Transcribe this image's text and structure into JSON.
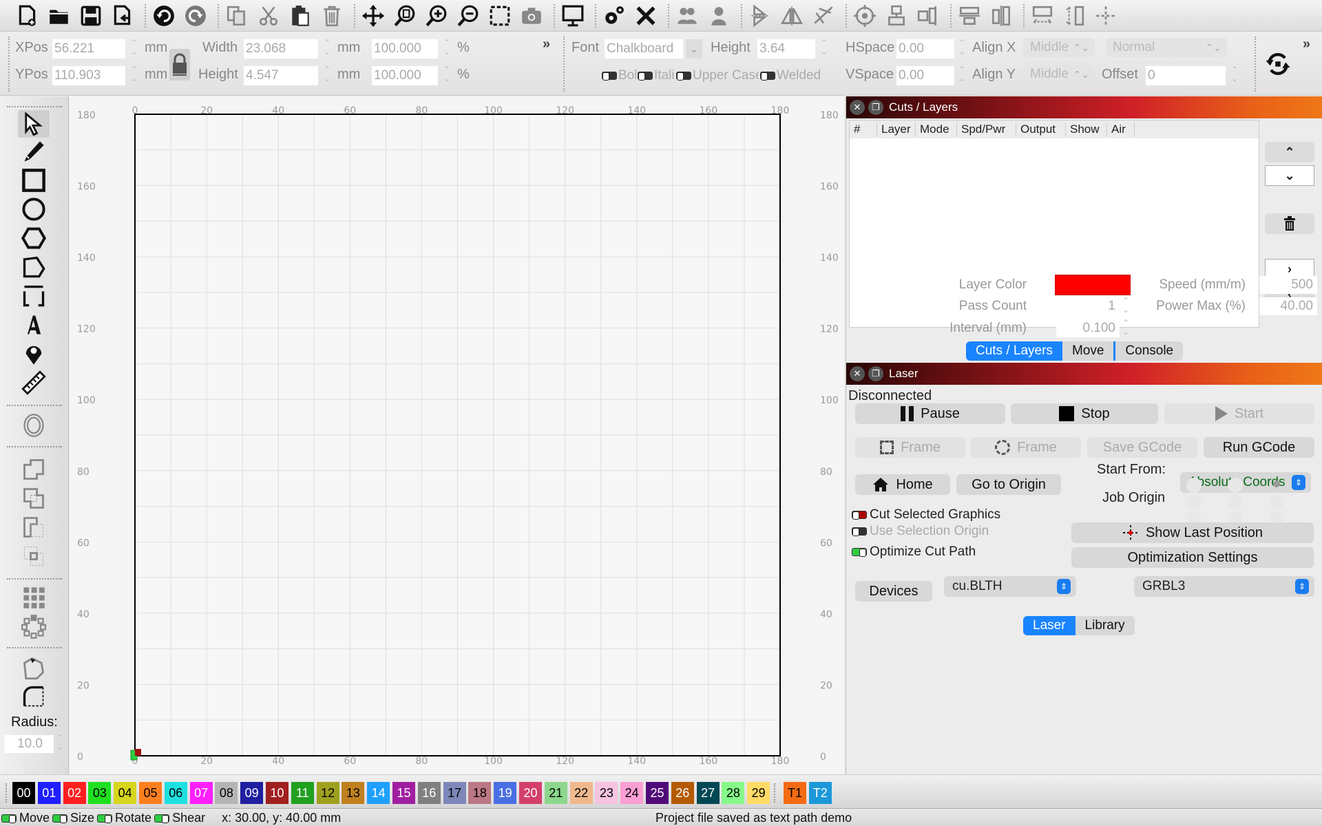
{
  "toolbar": {
    "icons": [
      "new-file-icon",
      "open-folder-icon",
      "save-icon",
      "import-icon",
      "undo-icon",
      "redo-icon",
      "copy-icon",
      "cut-icon",
      "paste-icon",
      "delete-icon",
      "move-icon",
      "zoom-to-page-icon",
      "zoom-in-icon",
      "zoom-out-icon",
      "frame-selection-icon",
      "camera-icon",
      "monitor-icon",
      "settings-icon",
      "tools-icon",
      "group-icon",
      "ungroup-icon",
      "flip-vertical-icon",
      "flip-horizontal-icon",
      "mirror-icon",
      "target-icon",
      "align-center-icon",
      "align-right-icon",
      "distribute-horizontal-icon",
      "distribute-vertical-icon",
      "resize-width-icon",
      "resize-height-icon",
      "dock-icon"
    ]
  },
  "properties": {
    "xpos_label": "XPos",
    "xpos_value": "56.221",
    "ypos_label": "YPos",
    "ypos_value": "110.903",
    "unit": "mm",
    "width_label": "Width",
    "width_value": "23.068",
    "height_label": "Height",
    "height_value": "4.547",
    "scale_w": "100.000",
    "scale_h": "100.000",
    "percent": "%",
    "more": "»"
  },
  "text_props": {
    "font_label": "Font",
    "font_value": "Chalkboard",
    "height_label": "Height",
    "height_value": "3.64",
    "hspace_label": "HSpace",
    "hspace_value": "0.00",
    "vspace_label": "VSpace",
    "vspace_value": "0.00",
    "alignx_label": "Align X",
    "alignx_value": "Middle",
    "aligny_label": "Align Y",
    "aligny_value": "Middle",
    "style_value": "Normal",
    "offset_label": "Offset",
    "offset_value": "0",
    "bold": "Bold",
    "italic": "Italic",
    "upper": "Upper Case",
    "welded": "Welded"
  },
  "left_tools": {
    "radius_label": "Radius:",
    "radius_value": "10.0"
  },
  "canvas": {
    "x_ticks": [
      "0",
      "20",
      "40",
      "60",
      "80",
      "100",
      "120",
      "140",
      "160",
      "180"
    ],
    "y_ticks": [
      "180",
      "160",
      "140",
      "120",
      "100",
      "80",
      "60",
      "40",
      "20",
      "0"
    ]
  },
  "cuts_panel": {
    "title": "Cuts / Layers",
    "columns": [
      "#",
      "Layer",
      "Mode",
      "Spd/Pwr",
      "Output",
      "Show",
      "Air"
    ],
    "layer_color_label": "Layer Color",
    "layer_color": "#ff0000",
    "speed_label": "Speed (mm/m)",
    "speed_value": "500",
    "pass_label": "Pass Count",
    "pass_value": "1",
    "power_label": "Power Max (%)",
    "power_value": "40.00",
    "interval_label": "Interval (mm)",
    "interval_value": "0.100",
    "tabs": [
      "Cuts / Layers",
      "Move",
      "Console"
    ]
  },
  "laser_panel": {
    "title": "Laser",
    "status": "Disconnected",
    "pause": "Pause",
    "stop": "Stop",
    "start": "Start",
    "frame1": "Frame",
    "frame2": "Frame",
    "save_gcode": "Save GCode",
    "run_gcode": "Run GCode",
    "home": "Home",
    "go_origin": "Go to Origin",
    "start_from_label": "Start From:",
    "start_from_value": "Absolute Coords",
    "job_origin_label": "Job Origin",
    "cut_selected": "Cut Selected Graphics",
    "use_sel_origin": "Use Selection Origin",
    "optimize": "Optimize Cut Path",
    "show_last": "Show Last Position",
    "opt_settings": "Optimization Settings",
    "devices": "Devices",
    "port": "cu.BLTH",
    "controller": "GRBL3",
    "tabs": [
      "Laser",
      "Library"
    ]
  },
  "palette": [
    {
      "label": "00",
      "bg": "#000000",
      "fg": "#ffffff"
    },
    {
      "label": "01",
      "bg": "#1f1fff",
      "fg": "#ffffff"
    },
    {
      "label": "02",
      "bg": "#ff1f1f",
      "fg": "#ffffff"
    },
    {
      "label": "03",
      "bg": "#1fe01f",
      "fg": "#000000"
    },
    {
      "label": "04",
      "bg": "#d6d61f",
      "fg": "#000000"
    },
    {
      "label": "05",
      "bg": "#ff7f1f",
      "fg": "#000000"
    },
    {
      "label": "06",
      "bg": "#1fe0e0",
      "fg": "#000000"
    },
    {
      "label": "07",
      "bg": "#ff1fff",
      "fg": "#ffffff"
    },
    {
      "label": "08",
      "bg": "#b4b4b4",
      "fg": "#000000"
    },
    {
      "label": "09",
      "bg": "#1f1fa0",
      "fg": "#ffffff"
    },
    {
      "label": "10",
      "bg": "#a01f1f",
      "fg": "#ffffff"
    },
    {
      "label": "11",
      "bg": "#1fa01f",
      "fg": "#ffffff"
    },
    {
      "label": "12",
      "bg": "#a0a01f",
      "fg": "#000000"
    },
    {
      "label": "13",
      "bg": "#c0801f",
      "fg": "#000000"
    },
    {
      "label": "14",
      "bg": "#1fa0ff",
      "fg": "#ffffff"
    },
    {
      "label": "15",
      "bg": "#a01fa0",
      "fg": "#ffffff"
    },
    {
      "label": "16",
      "bg": "#808080",
      "fg": "#ffffff"
    },
    {
      "label": "17",
      "bg": "#7d87b9",
      "fg": "#000000"
    },
    {
      "label": "18",
      "bg": "#bb7784",
      "fg": "#000000"
    },
    {
      "label": "19",
      "bg": "#4a6fe3",
      "fg": "#ffffff"
    },
    {
      "label": "20",
      "bg": "#d33f6a",
      "fg": "#ffffff"
    },
    {
      "label": "21",
      "bg": "#8cd78c",
      "fg": "#000000"
    },
    {
      "label": "22",
      "bg": "#f0b98d",
      "fg": "#000000"
    },
    {
      "label": "23",
      "bg": "#f6c4e1",
      "fg": "#000000"
    },
    {
      "label": "24",
      "bg": "#fa9ed4",
      "fg": "#000000"
    },
    {
      "label": "25",
      "bg": "#500a78",
      "fg": "#ffffff"
    },
    {
      "label": "26",
      "bg": "#b45a00",
      "fg": "#ffffff"
    },
    {
      "label": "27",
      "bg": "#004754",
      "fg": "#ffffff"
    },
    {
      "label": "28",
      "bg": "#86fa88",
      "fg": "#000000"
    },
    {
      "label": "29",
      "bg": "#ffdb66",
      "fg": "#000000"
    },
    {
      "label": "T1",
      "bg": "#f36b12",
      "fg": "#000000"
    },
    {
      "label": "T2",
      "bg": "#1b98d8",
      "fg": "#ffffff"
    }
  ],
  "statusbar": {
    "move": "Move",
    "size": "Size",
    "rotate": "Rotate",
    "shear": "Shear",
    "coords": "x: 30.00, y: 40.00 mm",
    "message": "Project file saved as text path demo"
  }
}
